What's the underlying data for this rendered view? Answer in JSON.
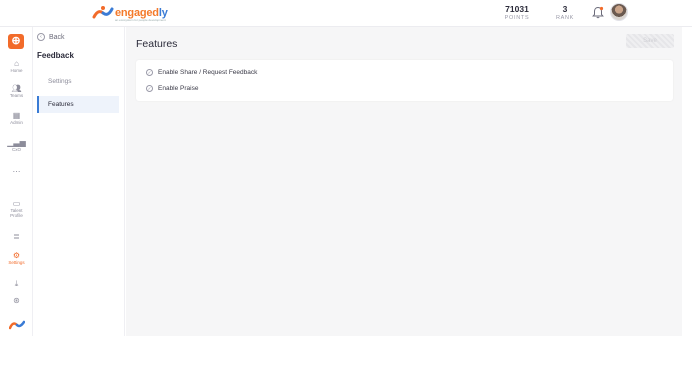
{
  "header": {
    "logo_text_a": "engaged",
    "logo_text_b": "ly",
    "logo_tagline": "an ecosystem for people development",
    "points_value": "71031",
    "points_label": "POINTS",
    "rank_value": "3",
    "rank_label": "RANK"
  },
  "rail": {
    "items": [
      {
        "label": "Home",
        "icon": "home-icon"
      },
      {
        "label": "Teams",
        "icon": "teams-icon"
      },
      {
        "label": "Admin",
        "icon": "admin-icon"
      },
      {
        "label": "CxO",
        "icon": "chart-icon"
      },
      {
        "label": "",
        "icon": "more-icon"
      },
      {
        "label": "Talent Profile",
        "icon": "talent-profile-icon"
      },
      {
        "label": "",
        "icon": "list-icon"
      },
      {
        "label": "Settings",
        "icon": "settings-icon"
      },
      {
        "label": "",
        "icon": "download-icon"
      },
      {
        "label": "",
        "icon": "help-icon"
      }
    ],
    "accent": "#f26b2a"
  },
  "subnav": {
    "back_label": "Back",
    "title": "Feedback",
    "items": [
      {
        "label": "Settings"
      },
      {
        "label": "Features"
      }
    ]
  },
  "main": {
    "title": "Features",
    "save_label": "Save",
    "features": [
      {
        "label": "Enable Share / Request Feedback"
      },
      {
        "label": "Enable Praise"
      }
    ]
  }
}
